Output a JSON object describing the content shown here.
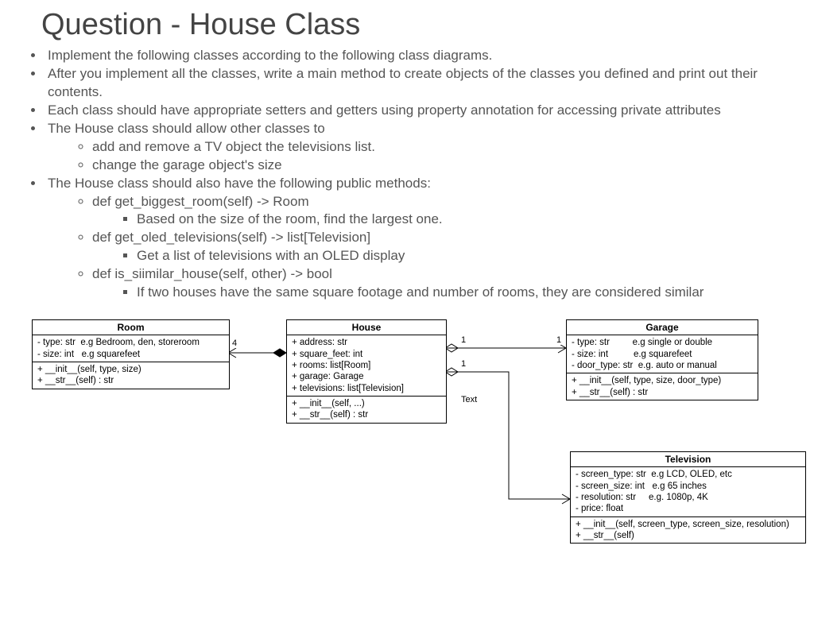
{
  "title": "Question - House Class",
  "bullets": {
    "b1": "Implement the following classes according to the following class diagrams.",
    "b2": "After you implement all the classes, write a main method to create objects of the classes you defined and print out their contents.",
    "b3": "Each class should have appropriate setters and getters using property annotation for accessing private attributes",
    "b4": "The House class should allow other classes to",
    "b4a": "add and remove a TV object the televisions list.",
    "b4b": "change the garage object's size",
    "b5": "The House class should also have the following public methods:",
    "b5a": "def get_biggest_room(self) -> Room",
    "b5a1": "Based on the size of the room, find the largest one.",
    "b5b": "def get_oled_televisions(self) -> list[Television]",
    "b5b1": "Get a list of televisions with an OLED display",
    "b5c": "def is_siimilar_house(self, other) -> bool",
    "b5c1": "If two houses have the same square footage and number of rooms, they are considered similar"
  },
  "uml": {
    "room": {
      "name": "Room",
      "attrs": "- type: str  e.g Bedroom, den, storeroom\n- size: int   e.g squarefeet",
      "ops": "+ __init__(self, type, size)\n+ __str__(self) : str"
    },
    "house": {
      "name": "House",
      "attrs": "+ address: str\n+ square_feet: int\n+ rooms: list[Room]\n+ garage: Garage\n+ televisions: list[Television]",
      "ops": "+ __init__(self, ...)\n+ __str__(self) : str"
    },
    "garage": {
      "name": "Garage",
      "attrs": "- type: str         e.g single or double\n- size: int          e.g squarefeet\n- door_type: str  e.g. auto or manual",
      "ops": "+ __init__(self, type, size, door_type)\n+ __str__(self) : str"
    },
    "television": {
      "name": "Television",
      "attrs": "- screen_type: str  e.g LCD, OLED, etc\n- screen_size: int   e.g 65 inches\n- resolution: str     e.g. 1080p, 4K\n- price: float",
      "ops": "+ __init__(self, screen_type, screen_size, resolution)\n+ __str__(self)"
    },
    "labels": {
      "text": "Text",
      "four": "4",
      "one_a": "1",
      "one_b": "1",
      "one_c": "1"
    }
  }
}
